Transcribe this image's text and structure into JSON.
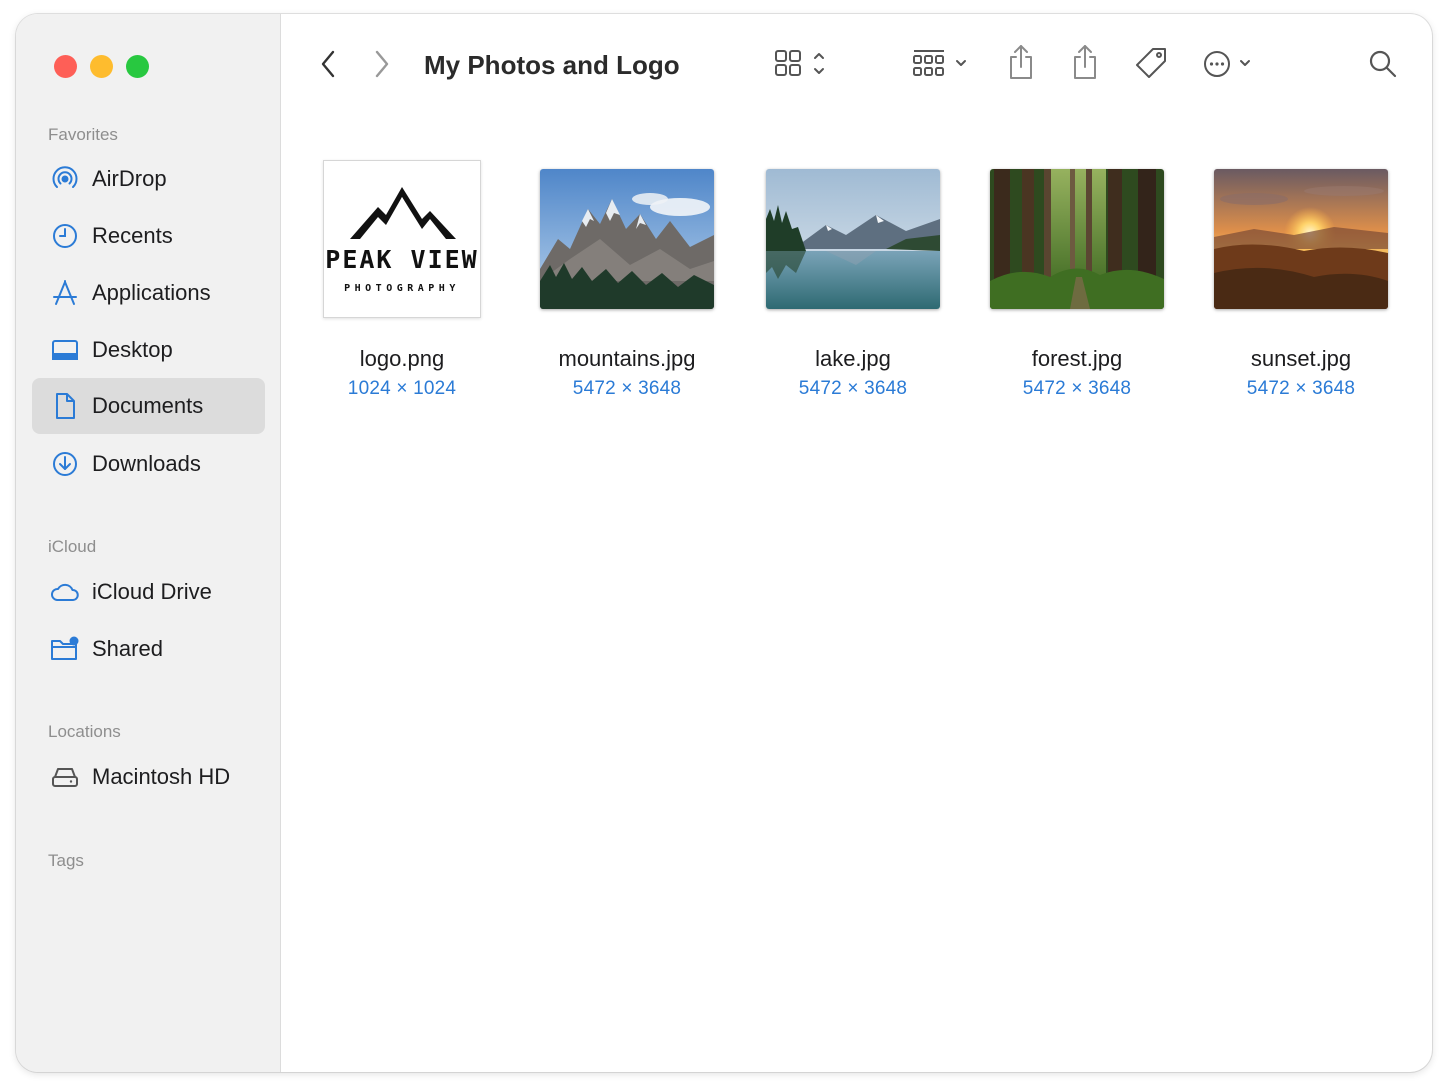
{
  "window": {
    "title": "My Photos and Logo"
  },
  "sidebar": {
    "sections": [
      {
        "title": "Favorites"
      },
      {
        "title": "iCloud"
      },
      {
        "title": "Locations"
      },
      {
        "title": "Tags"
      }
    ],
    "items": [
      {
        "label": "AirDrop",
        "icon": "airdrop-icon"
      },
      {
        "label": "Recents",
        "icon": "clock-icon"
      },
      {
        "label": "Applications",
        "icon": "applications-icon"
      },
      {
        "label": "Desktop",
        "icon": "desktop-icon"
      },
      {
        "label": "Documents",
        "icon": "document-icon",
        "selected": true
      },
      {
        "label": "Downloads",
        "icon": "download-icon"
      },
      {
        "label": "iCloud Drive",
        "icon": "cloud-icon"
      },
      {
        "label": "Shared",
        "icon": "shared-folder-icon"
      },
      {
        "label": "Macintosh HD",
        "icon": "hard-drive-icon"
      }
    ]
  },
  "toolbar": {
    "icons": [
      "back-icon",
      "forward-icon",
      "icon-view-icon",
      "group-icon",
      "share-icon",
      "share-icon",
      "tag-icon",
      "more-icon",
      "search-icon"
    ]
  },
  "files": [
    {
      "name": "logo.png",
      "dimensions": "1024 × 1024",
      "logo": {
        "line1": "PEAK VIEW",
        "line2": "PHOTOGRAPHY"
      }
    },
    {
      "name": "mountains.jpg",
      "dimensions": "5472 × 3648"
    },
    {
      "name": "lake.jpg",
      "dimensions": "5472 × 3648"
    },
    {
      "name": "forest.jpg",
      "dimensions": "5472 × 3648"
    },
    {
      "name": "sunset.jpg",
      "dimensions": "5472 × 3648"
    }
  ],
  "colors": {
    "accent": "#2b7bd6",
    "close": "#fe5f57",
    "minimize": "#febc2e",
    "zoom": "#28c840",
    "sidebar_bg": "#f1f1f1",
    "selected_bg": "#dcdcdc"
  }
}
